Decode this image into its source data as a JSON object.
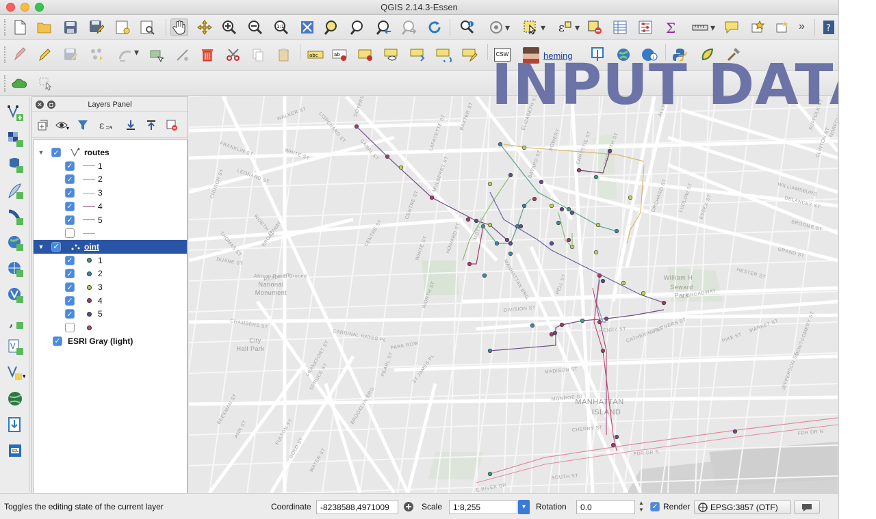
{
  "window": {
    "title": "QGIS 2.14.3-Essen"
  },
  "overlay": {
    "text": "INPUT DATA"
  },
  "toolbar": {
    "row1_icons": [
      "new-project-icon",
      "open-project-icon",
      "save-project-icon",
      "save-as-icon",
      "new-print-composer-icon",
      "composer-manager-icon",
      "pan-icon",
      "pan-to-selection-icon",
      "zoom-in-icon",
      "zoom-out-icon",
      "zoom-native-icon",
      "zoom-full-icon",
      "zoom-to-selection-icon",
      "zoom-to-layer-icon",
      "zoom-last-icon",
      "zoom-next-icon",
      "refresh-icon",
      "identify-icon",
      "action-icon",
      "select-icon",
      "measure-icon",
      "attribute-table-icon",
      "field-calculator-icon",
      "statistics-icon",
      "measure-line-icon",
      "annotation-icon",
      "tips-icon",
      "label-tool-icon"
    ],
    "more_label": "»",
    "user": {
      "name": "heming"
    },
    "csw_label": "CSW"
  },
  "panel": {
    "title": "Layers Panel",
    "layers": [
      {
        "name": "routes",
        "checked": true,
        "expanded": true,
        "kind": "group"
      },
      {
        "name": "1",
        "checked": true,
        "kind": "line",
        "color": "#5a9f8a"
      },
      {
        "name": "2",
        "checked": true,
        "kind": "line",
        "color": "#d9b86a"
      },
      {
        "name": "3",
        "checked": true,
        "kind": "line",
        "color": "#8cbc7a"
      },
      {
        "name": "4",
        "checked": true,
        "kind": "line",
        "color": "#7a3a6a"
      },
      {
        "name": "5",
        "checked": true,
        "kind": "line",
        "color": "#6b5fa0"
      },
      {
        "name": "",
        "checked": false,
        "kind": "line",
        "color": "#b8b84a"
      },
      {
        "name": "oint",
        "checked": true,
        "expanded": true,
        "kind": "group",
        "selected": true
      },
      {
        "name": "1",
        "checked": true,
        "kind": "point",
        "color": "#3f9a8a"
      },
      {
        "name": "2",
        "checked": true,
        "kind": "point",
        "color": "#3a86a8"
      },
      {
        "name": "3",
        "checked": true,
        "kind": "point",
        "color": "#bcd15a"
      },
      {
        "name": "4",
        "checked": true,
        "kind": "point",
        "color": "#a33a6a"
      },
      {
        "name": "5",
        "checked": true,
        "kind": "point",
        "color": "#5a4a8a"
      },
      {
        "name": "",
        "checked": false,
        "kind": "point",
        "color": "#b04a6a"
      },
      {
        "name": "ESRI Gray (light)",
        "checked": true,
        "kind": "raster"
      }
    ]
  },
  "map": {
    "labels": [
      {
        "t": "WALKER ST"
      },
      {
        "t": "LISPENARD ST"
      },
      {
        "t": "CANAL ST"
      },
      {
        "t": "WHITE ST"
      },
      {
        "t": "FRANKLIN ST"
      },
      {
        "t": "LEONARD ST"
      },
      {
        "t": "CHURCH ST"
      },
      {
        "t": "WORTH ST"
      },
      {
        "t": "THOMAS ST"
      },
      {
        "t": "BROADWAY"
      },
      {
        "t": "African Burial Ground"
      },
      {
        "t": "National"
      },
      {
        "t": "Monument"
      },
      {
        "t": "CENTRE ST"
      },
      {
        "t": "BAXTER ST"
      },
      {
        "t": "MULBERRY ST"
      },
      {
        "t": "MOTT ST"
      },
      {
        "t": "ELIZABETH ST"
      },
      {
        "t": "BOWERY"
      },
      {
        "t": "CHRYSTIE ST"
      },
      {
        "t": "FORSYTH ST"
      },
      {
        "t": "ALLEN ST"
      },
      {
        "t": "ORCHARD ST"
      },
      {
        "t": "LUDLOW ST"
      },
      {
        "t": "ESSEX ST"
      },
      {
        "t": "WILLIAMSBURG"
      },
      {
        "t": "DELANCEY ST"
      },
      {
        "t": "BROOME ST"
      },
      {
        "t": "GRAND ST"
      },
      {
        "t": "HESTER ST"
      },
      {
        "t": "DIVISION ST"
      },
      {
        "t": "E BROADWAY"
      },
      {
        "t": "HENRY ST"
      },
      {
        "t": "MADISON ST"
      },
      {
        "t": "MONROE ST"
      },
      {
        "t": "CHERRY ST"
      },
      {
        "t": "MANHATTAN BRG"
      },
      {
        "t": "MANHATTAN"
      },
      {
        "t": "ISLAND"
      },
      {
        "t": "FDR DR N"
      },
      {
        "t": "FDR DR S"
      },
      {
        "t": "SOUTH ST"
      },
      {
        "t": "E RIVER DR"
      },
      {
        "t": "CHAMBERS ST"
      },
      {
        "t": "READE ST"
      },
      {
        "t": "DUANE ST"
      },
      {
        "t": "City"
      },
      {
        "t": "Hall Park"
      },
      {
        "t": "PARK ROW"
      },
      {
        "t": "PEARL ST"
      },
      {
        "t": "FRANKFORT ST"
      },
      {
        "t": "SPRUCE ST"
      },
      {
        "t": "BEEKMAN ST"
      },
      {
        "t": "ANN ST"
      },
      {
        "t": "FULTON ST"
      },
      {
        "t": "GOLD ST"
      },
      {
        "t": "WATER ST"
      },
      {
        "t": "BROOKLYN BRG"
      },
      {
        "t": "CARDINAL HAYES PL"
      },
      {
        "t": "ST JAMES PL"
      },
      {
        "t": "William H"
      },
      {
        "t": "Seward"
      },
      {
        "t": "Park"
      },
      {
        "t": "RUTGERS ST"
      },
      {
        "t": "PIKE ST"
      },
      {
        "t": "MARKET ST"
      },
      {
        "t": "CATHERINE ST"
      },
      {
        "t": "MONTGOMERY ST"
      },
      {
        "t": "JEFFERSON ST"
      },
      {
        "t": "CLINTON ST"
      },
      {
        "t": "SUFFOLK ST"
      },
      {
        "t": "NORFOLK ST"
      },
      {
        "t": "LAFAYETTE ST"
      },
      {
        "t": "WHITE ST"
      },
      {
        "t": "HOWARD ST"
      },
      {
        "t": "BAYARD ST"
      },
      {
        "t": "PELL ST"
      },
      {
        "t": "DOYERS ST"
      },
      {
        "t": "WORTH ST"
      },
      {
        "t": "CENTRE ST"
      }
    ]
  },
  "status": {
    "message": "Toggles the editing state of the current layer",
    "coordinate_label": "Coordinate",
    "coordinate_value": "-8238588,4971009",
    "scale_label": "Scale",
    "scale_value": "1:8,255",
    "rotation_label": "Rotation",
    "rotation_value": "0.0",
    "render_label": "Render",
    "crs_label": "EPSG:3857 (OTF)"
  }
}
